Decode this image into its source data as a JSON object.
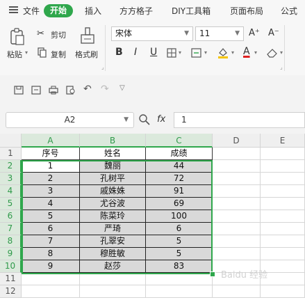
{
  "menu": {
    "file": "文件",
    "tabs": [
      "开始",
      "插入",
      "方方格子",
      "DIY工具箱",
      "页面布局",
      "公式"
    ]
  },
  "ribbon": {
    "paste": "粘贴",
    "cut": "剪切",
    "copy": "复制",
    "format_painter": "格式刷",
    "font_name": "宋体",
    "font_size": "11",
    "bold": "B",
    "italic": "I",
    "underline": "U",
    "font_color_letter": "A",
    "grow_font": "A⁺",
    "shrink_font": "A⁻"
  },
  "formula_bar": {
    "name_box": "A2",
    "fx": "fx",
    "value": "1"
  },
  "grid": {
    "columns": [
      "A",
      "B",
      "C",
      "D",
      "E"
    ],
    "rows": [
      "1",
      "2",
      "3",
      "4",
      "5",
      "6",
      "7",
      "8",
      "9",
      "10",
      "11",
      "12"
    ],
    "header": [
      "序号",
      "姓名",
      "成绩"
    ],
    "data": [
      [
        "1",
        "魏丽",
        "44"
      ],
      [
        "2",
        "孔树平",
        "72"
      ],
      [
        "3",
        "戚姝姝",
        "91"
      ],
      [
        "4",
        "尤谷波",
        "69"
      ],
      [
        "5",
        "陈菜玲",
        "100"
      ],
      [
        "6",
        "严琦",
        "6"
      ],
      [
        "7",
        "孔翠安",
        "5"
      ],
      [
        "8",
        "穆胜敏",
        "5"
      ],
      [
        "9",
        "赵莎",
        "83"
      ]
    ]
  },
  "colors": {
    "accent": "#2fa74c",
    "selection_fill": "#d9d9d9"
  }
}
